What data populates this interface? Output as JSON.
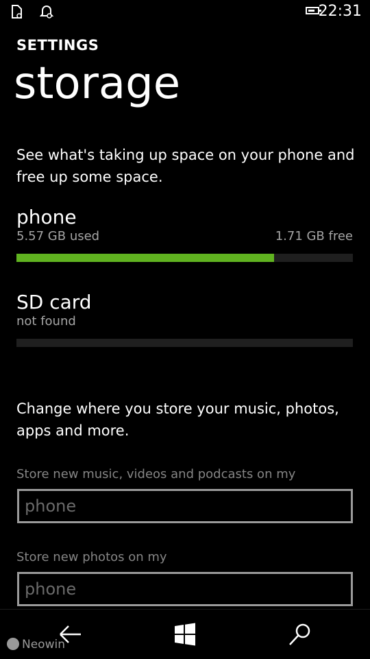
{
  "status_bar": {
    "time": "22:31",
    "battery_level": 0.75,
    "icons": [
      "sim-icon",
      "quiet-hours-icon",
      "battery-icon"
    ]
  },
  "header": {
    "section": "SETTINGS",
    "title": "storage"
  },
  "description": "See what's taking up space on your phone and free up some space.",
  "storage": {
    "phone": {
      "name": "phone",
      "used": "5.57 GB used",
      "free": "1.71 GB free",
      "used_fraction": 0.765,
      "fill_color": "#60b320"
    },
    "sd_card": {
      "name": "SD card",
      "status": "not found",
      "used_fraction": 0
    }
  },
  "change_text": "Change where you store your music, photos, apps and more.",
  "fields": {
    "music": {
      "label": "Store new music, videos and podcasts on my",
      "value": "phone"
    },
    "photos": {
      "label": "Store new photos on my",
      "value": "phone"
    }
  },
  "navbar": {
    "icons": [
      "back-icon",
      "windows-icon",
      "search-icon"
    ]
  },
  "watermark": "Neowin"
}
